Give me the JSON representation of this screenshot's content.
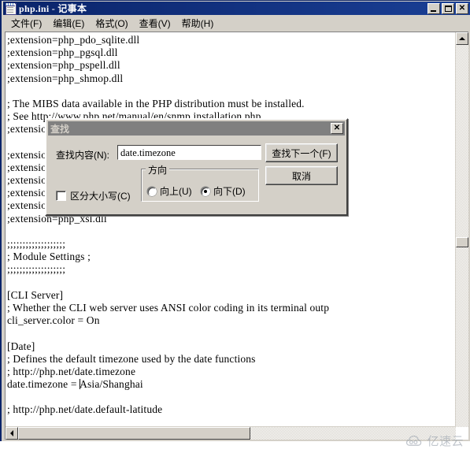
{
  "window": {
    "title": "php.ini - 记事本",
    "icon": "notepad-icon",
    "buttons": {
      "minimize": "_",
      "maximize": "□",
      "close": "✕"
    }
  },
  "menu": {
    "items": [
      {
        "label": "文件(F)"
      },
      {
        "label": "编辑(E)"
      },
      {
        "label": "格式(O)"
      },
      {
        "label": "查看(V)"
      },
      {
        "label": "帮助(H)"
      }
    ]
  },
  "editor": {
    "lines": [
      ";extension=php_pdo_sqlite.dll",
      ";extension=php_pgsql.dll",
      ";extension=php_pspell.dll",
      ";extension=php_shmop.dll",
      "",
      "; The MIBS data available in the PHP distribution must be installed.",
      "; See http://www.php.net/manual/en/snmp.installation.php",
      ";extension=php_snmp.dll",
      "",
      ";extension=php_soap.dll",
      ";extension=php_sockets.dll",
      ";extension=php_sqlite3.dll",
      ";extension=php_tidy.dll",
      ";extension=php_xmlrpc.dll",
      ";extension=php_xsl.dll",
      "",
      ";;;;;;;;;;;;;;;;;;;",
      "; Module Settings ;",
      ";;;;;;;;;;;;;;;;;;;",
      "",
      "[CLI Server]",
      "; Whether the CLI web server uses ANSI color coding in its terminal outp",
      "cli_server.color = On",
      "",
      "[Date]",
      "; Defines the default timezone used by the date functions",
      "; http://php.net/date.timezone",
      "date.timezone = Asia/Shanghai",
      "",
      "; http://php.net/date.default-latitude"
    ],
    "caret_line_index": 27,
    "caret_column": 16,
    "scrollbars": {
      "vertical_thumb_top_pct": 53,
      "horizontal_thumb_width_pct": 53
    }
  },
  "find_dialog": {
    "title": "查找",
    "close_label": "✕",
    "find_what_label": "查找内容(N):",
    "find_what_value": "date.timezone",
    "find_next_label": "查找下一个(F)",
    "cancel_label": "取消",
    "direction_legend": "方向",
    "direction_up_label": "向上(U)",
    "direction_down_label": "向下(D)",
    "direction_selected": "down",
    "match_case_label": "区分大小写(C)",
    "match_case_checked": false
  },
  "watermark": {
    "text": "亿速云",
    "icon": "cloud-eyes-logo",
    "color": "#9aa3ad"
  },
  "colors": {
    "titlebar_active": "#0a246a",
    "titlebar_inactive": "#808080",
    "window_face": "#d4d0c8",
    "editor_bg": "#ffffff",
    "text": "#000000"
  }
}
